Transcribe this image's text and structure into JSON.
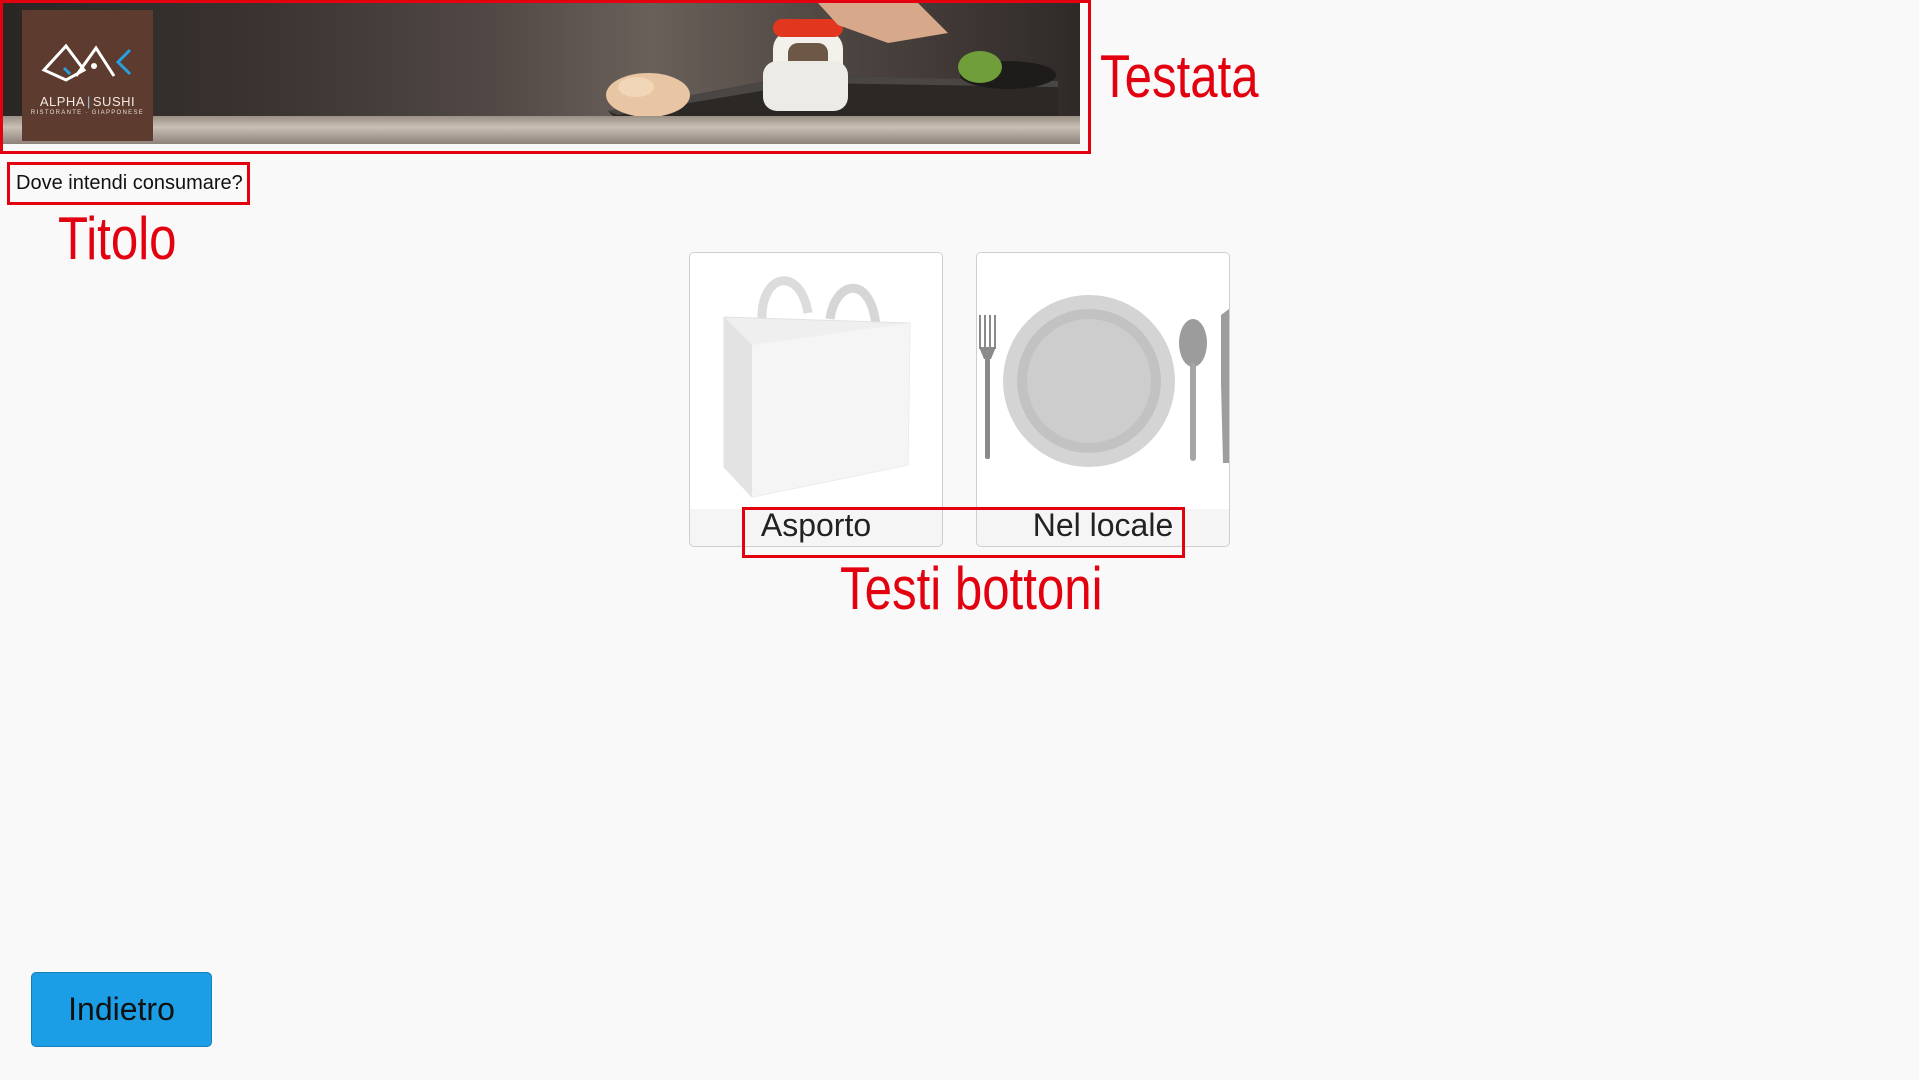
{
  "header": {
    "brand_left": "ALPHA",
    "brand_sep": "|",
    "brand_right": "SUSHI",
    "tagline": "RISTORANTE · GIAPPONESE"
  },
  "page": {
    "title": "Dove intendi consumare?"
  },
  "choices": [
    {
      "label": "Asporto",
      "icon": "shopping-bag-icon"
    },
    {
      "label": "Nel locale",
      "icon": "plate-cutlery-icon"
    }
  ],
  "footer": {
    "back_label": "Indietro"
  },
  "annotations": {
    "header_label": "Testata",
    "title_label": "Titolo",
    "buttons_label": "Testi bottoni"
  },
  "colors": {
    "annotation": "#e3000f",
    "back_button": "#1b9ee6",
    "logo_bg": "#5d3b2e",
    "background": "#f9f9f9"
  }
}
